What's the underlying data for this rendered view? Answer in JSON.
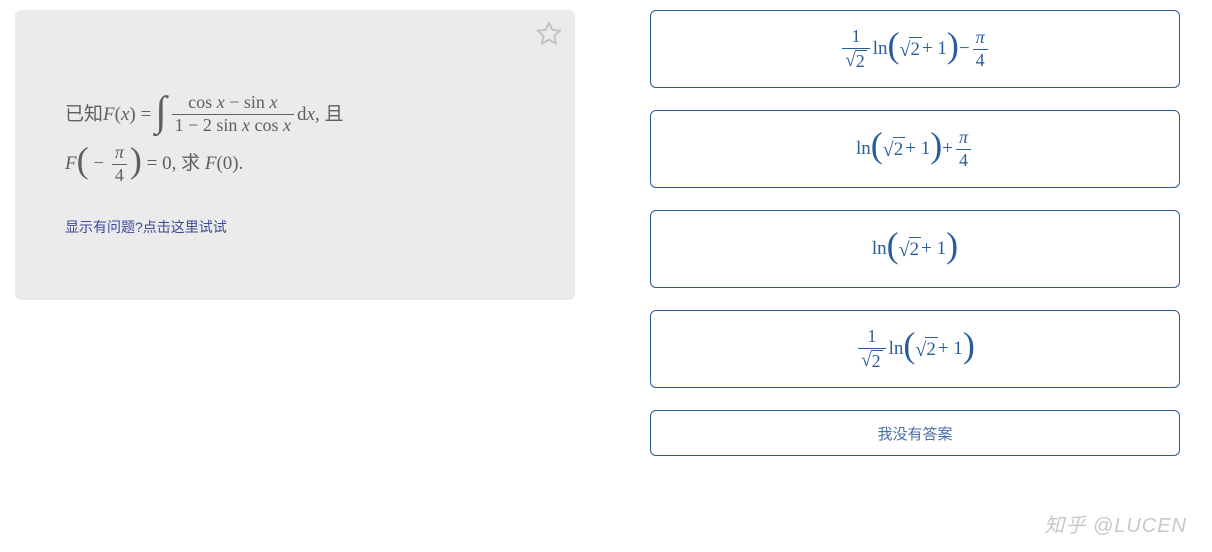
{
  "question": {
    "prefix": "已知 ",
    "func_name": "F",
    "var": "x",
    "eq1_lhs_open": "(",
    "eq1_lhs_close": ") = ",
    "integral_num_a": "cos ",
    "integral_num_op": " − ",
    "integral_num_b": "sin ",
    "integral_den_a": "1 − 2 sin ",
    "integral_den_b": " cos ",
    "dx": " d",
    "after_integral": ", 且",
    "line2_open": "( − ",
    "pi": "π",
    "four": "4",
    "line2_close": " ) = 0, 求 ",
    "line2_end": "(0).",
    "hint": "显示有问题?点击这里试试"
  },
  "options": {
    "a": {
      "coef_num": "1",
      "coef_den_root": "2",
      "ln": "ln",
      "root_in": "2",
      "plus1": " + 1",
      "tail_op": " − ",
      "tail_num": "π",
      "tail_den": "4"
    },
    "b": {
      "ln": "ln",
      "root_in": "2",
      "plus1": " + 1",
      "tail_op": " + ",
      "tail_num": "π",
      "tail_den": "4"
    },
    "c": {
      "ln": "ln",
      "root_in": "2",
      "plus1": " + 1"
    },
    "d": {
      "coef_num": "1",
      "coef_den_root": "2",
      "ln": "ln",
      "root_in": "2",
      "plus1": " + 1"
    },
    "e_label": "我没有答案"
  },
  "watermark": "知乎 @LUCEN"
}
